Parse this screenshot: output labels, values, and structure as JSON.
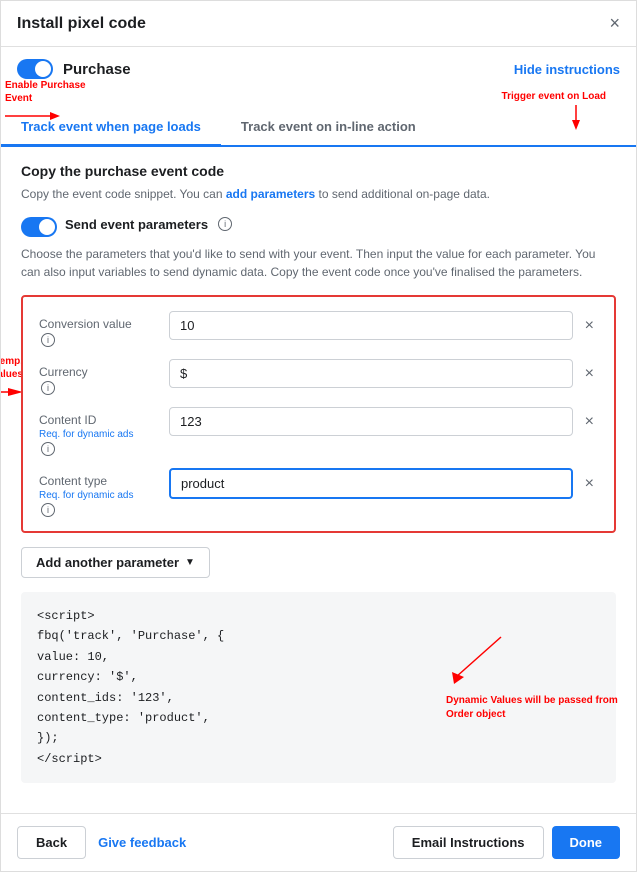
{
  "modal": {
    "title": "Install pixel code",
    "close_label": "×"
  },
  "topbar": {
    "toggle_label": "Purchase",
    "hide_instructions_label": "Hide instructions"
  },
  "tabs": [
    {
      "label": "Track event when page loads",
      "active": true
    },
    {
      "label": "Track event on in-line action",
      "active": false
    }
  ],
  "section": {
    "title": "Copy the purchase event code",
    "desc_prefix": "Copy the event code snippet. You can ",
    "desc_link": "add parameters",
    "desc_suffix": " to send additional on-page data."
  },
  "send_params_toggle": {
    "label": "Send event parameters",
    "desc": "Choose the parameters that you'd like to send with your event. Then input the value for each parameter. You can also input variables to send dynamic data. Copy the event code once you've finalised the parameters."
  },
  "params": [
    {
      "label": "Conversion value",
      "sublabel": "",
      "value": "10",
      "has_info": true,
      "req_dynamic": false
    },
    {
      "label": "Currency",
      "sublabel": "",
      "value": "$",
      "has_info": true,
      "req_dynamic": false
    },
    {
      "label": "Content ID",
      "sublabel": "Req. for dynamic ads",
      "value": "123",
      "has_info": true,
      "req_dynamic": true
    },
    {
      "label": "Content type",
      "sublabel": "Req. for dynamic ads",
      "value": "product",
      "has_info": true,
      "req_dynamic": true,
      "highlighted": true
    }
  ],
  "add_param_button": "Add another parameter",
  "code": {
    "line1": "<script>",
    "line2": "  fbq('track', 'Purchase', {",
    "line3": "    value: 10,",
    "line4": "    currency: '$',",
    "line5": "    content_ids: '123',",
    "line6": "    content_type: 'product',",
    "line7": "  });",
    "line8": "</script>"
  },
  "annotations": {
    "enable_purchase": "Enable Purchase\nEvent",
    "trigger_event": "Trigger event on Load",
    "enter_temp": "Enter temp.\nvalues",
    "dynamic_values": "Dynamic Values will be passed from Order object"
  },
  "footer": {
    "back_label": "Back",
    "feedback_label": "Give feedback",
    "email_label": "Email Instructions",
    "done_label": "Done"
  }
}
